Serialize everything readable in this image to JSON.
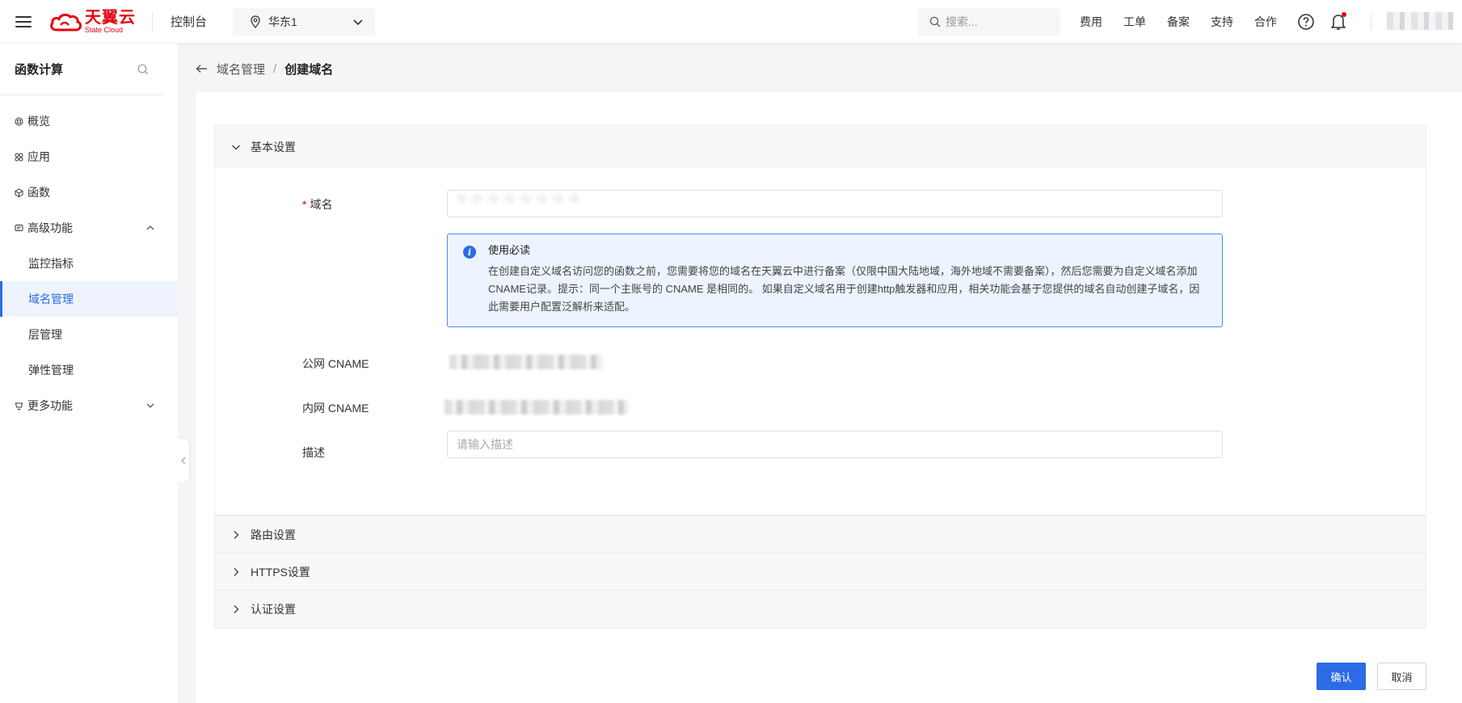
{
  "header": {
    "logo_cn": "天翼云",
    "logo_en": "State Cloud",
    "console_label": "控制台",
    "region": "华东1",
    "search_placeholder": "搜索...",
    "nav": [
      "费用",
      "工单",
      "备案",
      "支持",
      "合作"
    ]
  },
  "sidebar": {
    "title": "函数计算",
    "items": [
      {
        "label": "概览",
        "icon": "overview-icon"
      },
      {
        "label": "应用",
        "icon": "apps-icon"
      },
      {
        "label": "函数",
        "icon": "function-icon"
      },
      {
        "label": "高级功能",
        "icon": "advanced-icon",
        "expanded": true
      },
      {
        "label": "监控指标",
        "sub": true
      },
      {
        "label": "域名管理",
        "sub": true,
        "active": true
      },
      {
        "label": "层管理",
        "sub": true
      },
      {
        "label": "弹性管理",
        "sub": true
      },
      {
        "label": "更多功能",
        "icon": "more-icon",
        "expanded": false
      }
    ]
  },
  "breadcrumb": {
    "parent": "域名管理",
    "separator": "/",
    "current": "创建域名"
  },
  "form": {
    "section_basic": "基本设置",
    "domain_label": "域名",
    "required_mark": "*",
    "notice_title": "使用必读",
    "notice_body": "在创建自定义域名访问您的函数之前，您需要将您的域名在天翼云中进行备案（仅限中国大陆地域，海外地域不需要备案），然后您需要为自定义域名添加CNAME记录。提示：同一个主账号的 CNAME 是相同的。 如果自定义域名用于创建http触发器和应用，相关功能会基于您提供的域名自动创建子域名，因此需要用户配置泛解析来适配。",
    "public_cname_label": "公网 CNAME",
    "private_cname_label": "内网 CNAME",
    "desc_label": "描述",
    "desc_placeholder": "请输入描述",
    "section_route": "路由设置",
    "section_https": "HTTPS设置",
    "section_auth": "认证设置"
  },
  "actions": {
    "confirm": "确认",
    "cancel": "取消"
  },
  "colors": {
    "brand": "#e60012",
    "primary": "#2c6be6"
  }
}
